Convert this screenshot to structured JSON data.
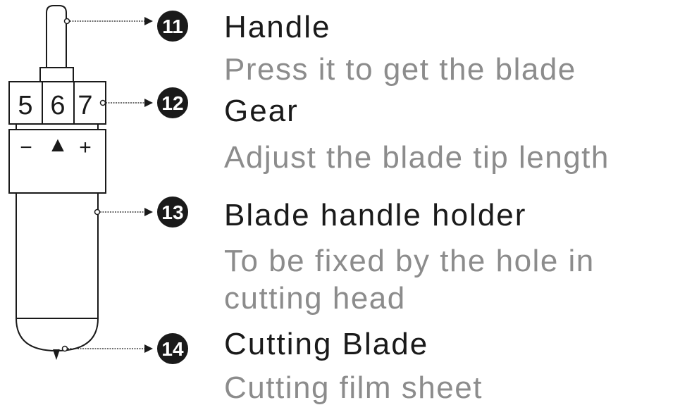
{
  "gear": {
    "numbers": [
      "5",
      "6",
      "7"
    ],
    "minus": "−",
    "arrow": "▲",
    "plus": "+"
  },
  "callouts": [
    {
      "number": "11",
      "title": "Handle",
      "description": [
        "Press it to get the blade"
      ]
    },
    {
      "number": "12",
      "title": "Gear",
      "description": [
        "Adjust the blade tip length"
      ]
    },
    {
      "number": "13",
      "title": "Blade handle holder",
      "description": [
        "To be fixed by the hole in",
        "cutting head"
      ]
    },
    {
      "number": "14",
      "title": "Cutting Blade",
      "description": [
        "Cutting film sheet"
      ]
    }
  ]
}
